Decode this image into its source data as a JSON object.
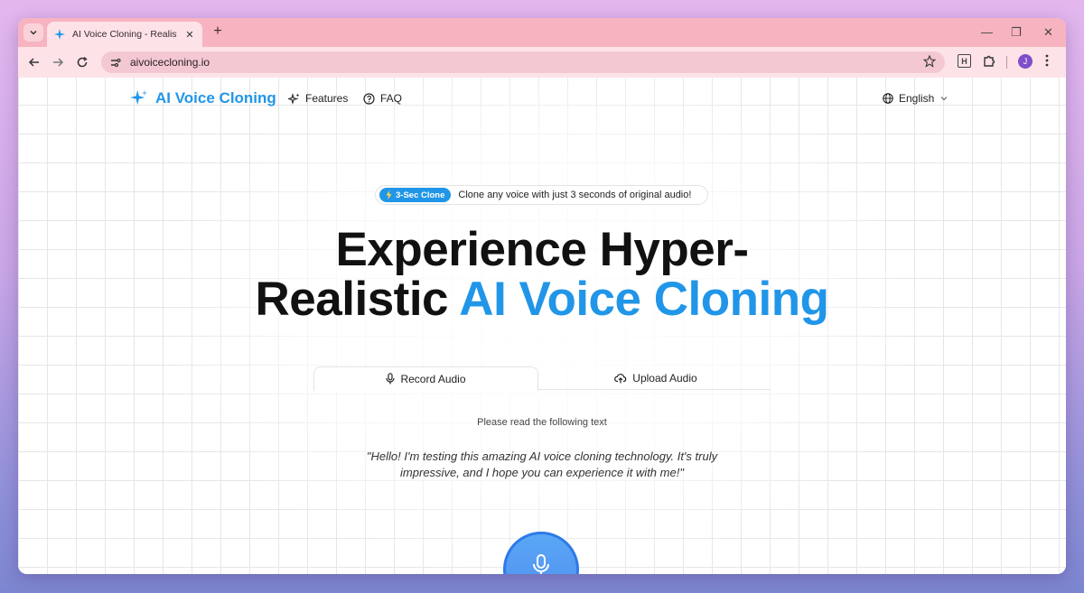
{
  "browser": {
    "tab_title": "AI Voice Cloning - Realistic AI V",
    "url": "aivoicecloning.io",
    "profile_initial": "J",
    "extension_label": "H"
  },
  "nav": {
    "brand": "AI Voice Cloning",
    "links": [
      "Features",
      "FAQ"
    ],
    "language": "English"
  },
  "badge": {
    "tag": "3-Sec Clone",
    "text": "Clone any voice with just 3 seconds of original audio!"
  },
  "hero": {
    "line1": "Experience Hyper-",
    "line2_plain": "Realistic ",
    "line2_accent": "AI Voice Cloning"
  },
  "tabs": {
    "record": "Record Audio",
    "upload": "Upload Audio"
  },
  "reading": {
    "prompt": "Please read the following text",
    "quote": "\"Hello! I'm testing this amazing AI voice cloning technology. It's truly impressive, and I hope you can experience it with me!\""
  },
  "colors": {
    "accent": "#2196e8",
    "tabstrip": "#f8b3c0"
  }
}
